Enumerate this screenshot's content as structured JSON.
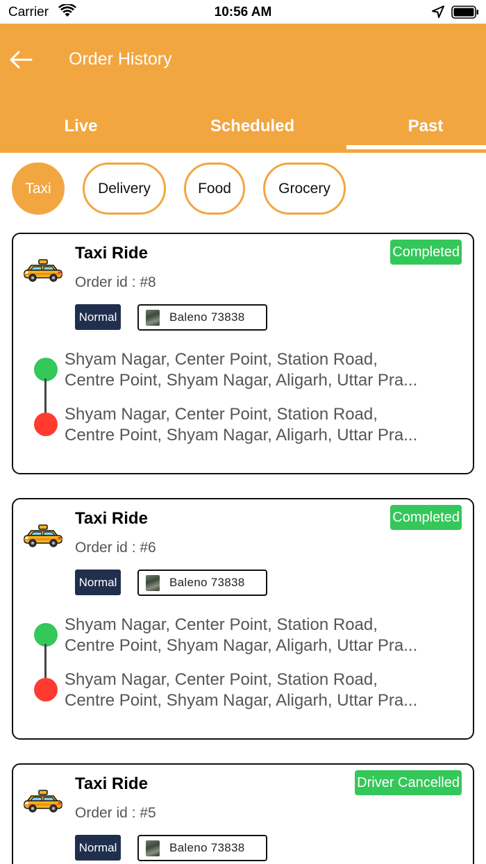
{
  "status_bar": {
    "carrier": "Carrier",
    "time": "10:56 AM"
  },
  "header": {
    "title": "Order History",
    "background_color": "#f2a640"
  },
  "tabs": [
    {
      "label": "Live",
      "active": false
    },
    {
      "label": "Scheduled",
      "active": false
    },
    {
      "label": "Past",
      "active": true
    }
  ],
  "categories": [
    {
      "label": "Taxi",
      "active": true
    },
    {
      "label": "Delivery",
      "active": false
    },
    {
      "label": "Food",
      "active": false
    },
    {
      "label": "Grocery",
      "active": false
    }
  ],
  "orders": [
    {
      "title": "Taxi Ride",
      "order_id": "Order id : #8",
      "status": "Completed",
      "status_color": "#34c759",
      "ride_type": "Normal",
      "vehicle": "Baleno 73838",
      "pickup": "Shyam Nagar, Center Point, Station Road,\nCentre Point, Shyam Nagar, Aligarh, Uttar Pra...",
      "drop": "Shyam Nagar, Center Point, Station Road,\nCentre Point, Shyam Nagar, Aligarh, Uttar Pra..."
    },
    {
      "title": "Taxi Ride",
      "order_id": "Order id : #6",
      "status": "Completed",
      "status_color": "#34c759",
      "ride_type": "Normal",
      "vehicle": "Baleno 73838",
      "pickup": "Shyam Nagar, Center Point, Station Road,\nCentre Point, Shyam Nagar, Aligarh, Uttar Pra...",
      "drop": "Shyam Nagar, Center Point, Station Road,\nCentre Point, Shyam Nagar, Aligarh, Uttar Pra..."
    },
    {
      "title": "Taxi Ride",
      "order_id": "Order id : #5",
      "status": "Driver Cancelled",
      "status_color": "#34c759",
      "ride_type": "Normal",
      "vehicle": "Baleno 73838"
    }
  ],
  "icons": {
    "back": "arrow-left-icon",
    "taxi": "taxi-icon",
    "wifi": "wifi-icon",
    "location": "location-arrow-icon",
    "battery": "battery-icon"
  }
}
